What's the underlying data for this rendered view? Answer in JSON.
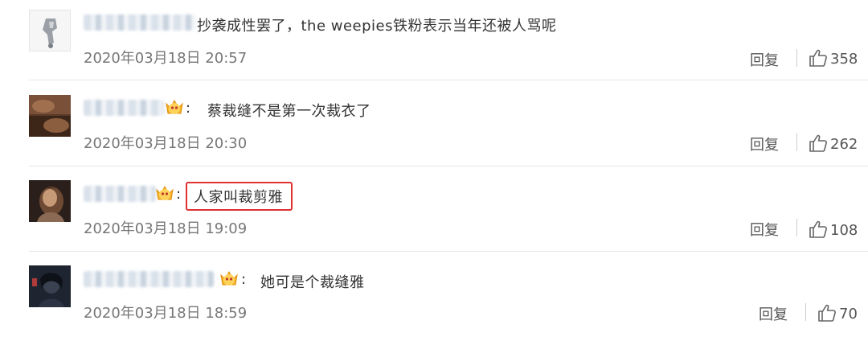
{
  "comments": [
    {
      "text": "抄袭成性罢了，the weepies铁粉表示当年还被人骂呢",
      "date": "2020年03月18日 20:57",
      "reply_label": "回复",
      "likes": "358",
      "has_crown": false,
      "boxed": false
    },
    {
      "text": "蔡裁缝不是第一次裁衣了",
      "date": "2020年03月18日 20:30",
      "reply_label": "回复",
      "likes": "262",
      "has_crown": true,
      "boxed": false
    },
    {
      "text": "人家叫裁剪雅",
      "date": "2020年03月18日 19:09",
      "reply_label": "回复",
      "likes": "108",
      "has_crown": true,
      "boxed": true
    },
    {
      "text": "她可是个裁缝雅",
      "date": "2020年03月18日 18:59",
      "reply_label": "回复",
      "likes": "70",
      "has_crown": true,
      "boxed": false
    }
  ],
  "colors": {
    "highlight_box": "#e03030",
    "divider": "#e6e6e6",
    "date_text": "#777777"
  }
}
